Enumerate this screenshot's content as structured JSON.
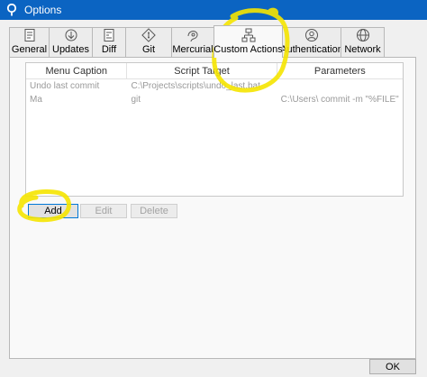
{
  "window": {
    "title": "Options"
  },
  "tabs": [
    {
      "id": "general",
      "label": "General",
      "icon": "general-icon"
    },
    {
      "id": "updates",
      "label": "Updates",
      "icon": "updates-icon"
    },
    {
      "id": "diff",
      "label": "Diff",
      "icon": "diff-icon"
    },
    {
      "id": "git",
      "label": "Git",
      "icon": "git-icon"
    },
    {
      "id": "mercurial",
      "label": "Mercurial",
      "icon": "mercurial-icon"
    },
    {
      "id": "custom-actions",
      "label": "Custom Actions",
      "icon": "custom-actions-icon",
      "active": true
    },
    {
      "id": "authentication",
      "label": "Authentication",
      "icon": "authentication-icon"
    },
    {
      "id": "network",
      "label": "Network",
      "icon": "network-icon"
    }
  ],
  "actions_table": {
    "columns": [
      "Menu Caption",
      "Script Target",
      "Parameters"
    ],
    "rows": [
      [
        "Undo last commit",
        "C:\\Projects\\scripts\\undo_last.bat",
        ""
      ],
      [
        "Ma",
        "git",
        "C:\\Users\\  commit -m \"%FILE\""
      ]
    ]
  },
  "buttons": {
    "add": "Add",
    "edit": "Edit",
    "delete": "Delete",
    "ok": "OK"
  },
  "colors": {
    "titlebar": "#0b64c2",
    "highlight": "#f5e400",
    "focus": "#0078d7"
  }
}
